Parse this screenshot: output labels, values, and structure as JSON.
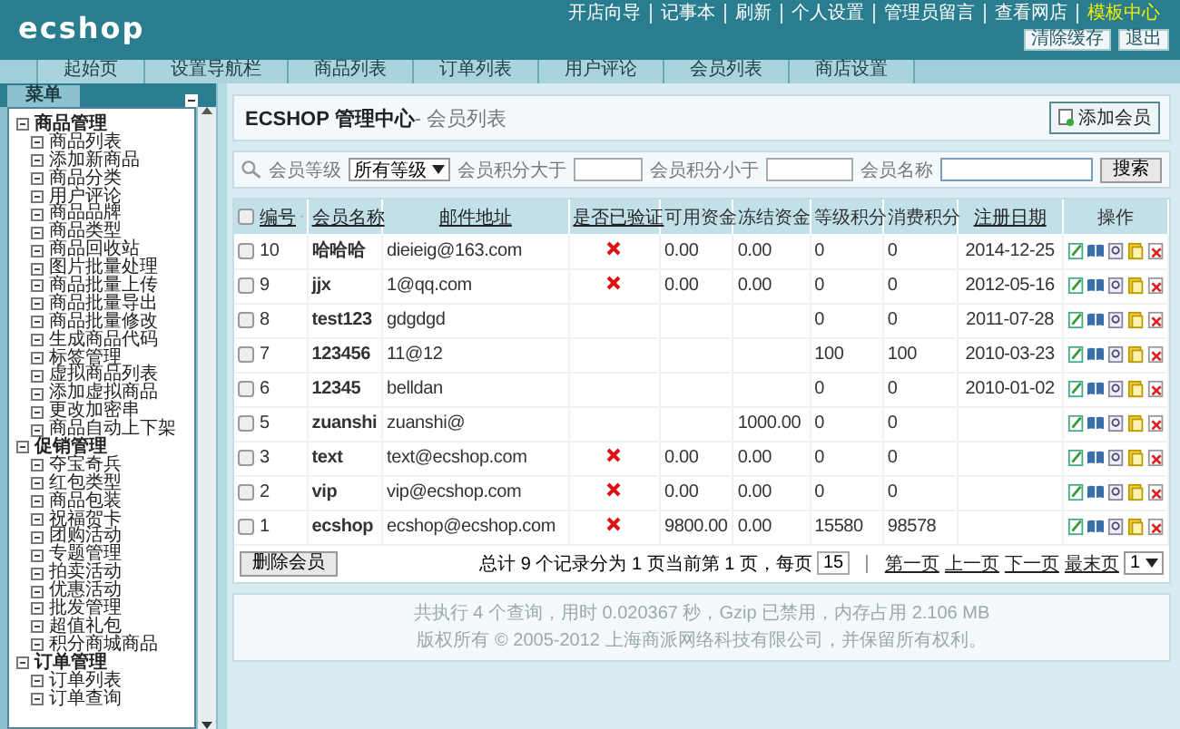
{
  "header": {
    "logo": "ecshop",
    "links": [
      {
        "label": "开店向导",
        "highlighted": false
      },
      {
        "label": "记事本",
        "highlighted": false
      },
      {
        "label": "刷新",
        "highlighted": false
      },
      {
        "label": "个人设置",
        "highlighted": false
      },
      {
        "label": "管理员留言",
        "highlighted": false
      },
      {
        "label": "查看网店",
        "highlighted": false
      },
      {
        "label": "模板中心",
        "highlighted": true
      }
    ],
    "buttons": [
      "清除缓存",
      "退出"
    ]
  },
  "nav_tabs": [
    "起始页",
    "设置导航栏",
    "商品列表",
    "订单列表",
    "用户评论",
    "会员列表",
    "商店设置"
  ],
  "sidebar": {
    "title": "菜单",
    "groups": [
      {
        "label": "商品管理",
        "expanded": true,
        "children": [
          "商品列表",
          "添加新商品",
          "商品分类",
          "用户评论",
          "商品品牌",
          "商品类型",
          "商品回收站",
          "图片批量处理",
          "商品批量上传",
          "商品批量导出",
          "商品批量修改",
          "生成商品代码",
          "标签管理",
          "虚拟商品列表",
          "添加虚拟商品",
          "更改加密串",
          "商品自动上下架"
        ]
      },
      {
        "label": "促销管理",
        "expanded": true,
        "children": [
          "夺宝奇兵",
          "红包类型",
          "商品包装",
          "祝福贺卡",
          "团购活动",
          "专题管理",
          "拍卖活动",
          "优惠活动",
          "批发管理",
          "超值礼包",
          "积分商城商品"
        ]
      },
      {
        "label": "订单管理",
        "expanded": true,
        "children": [
          "订单列表",
          "订单查询"
        ]
      }
    ]
  },
  "page_title": {
    "main": "ECSHOP 管理中心",
    "sub": "- 会员列表",
    "action": "添加会员"
  },
  "search": {
    "level_label": "会员等级",
    "level_value": "所有等级",
    "min_label": "会员积分大于",
    "max_label": "会员积分小于",
    "name_label": "会员名称",
    "button": "搜索"
  },
  "table": {
    "select_all": {
      "checked": false
    },
    "columns": [
      "编号",
      "会员名称",
      "邮件地址",
      "是否已验证",
      "可用资金",
      "冻结资金",
      "等级积分",
      "消费积分",
      "注册日期",
      "操作"
    ],
    "rows": [
      {
        "id": "10",
        "name": "哈哈哈",
        "email": "dieieig@163.com",
        "verified": false,
        "available": "0.00",
        "frozen": "0.00",
        "rank_points": "0",
        "pay_points": "0",
        "reg_date": "2014-12-25",
        "checked": false
      },
      {
        "id": "9",
        "name": "jjx",
        "email": "1@qq.com",
        "verified": false,
        "available": "0.00",
        "frozen": "0.00",
        "rank_points": "0",
        "pay_points": "0",
        "reg_date": "2012-05-16",
        "checked": false
      },
      {
        "id": "8",
        "name": "test123",
        "email": "gdgdgd",
        "verified": null,
        "available": "",
        "frozen": "",
        "rank_points": "0",
        "pay_points": "0",
        "reg_date": "2011-07-28",
        "checked": false
      },
      {
        "id": "7",
        "name": "123456",
        "email": "11@12",
        "verified": null,
        "available": "",
        "frozen": "",
        "rank_points": "100",
        "pay_points": "100",
        "reg_date": "2010-03-23",
        "checked": false
      },
      {
        "id": "6",
        "name": "12345",
        "email": "belldan",
        "verified": null,
        "available": "",
        "frozen": "",
        "rank_points": "0",
        "pay_points": "0",
        "reg_date": "2010-01-02",
        "checked": false
      },
      {
        "id": "5",
        "name": "zuanshi",
        "email": "zuanshi@",
        "verified": null,
        "available": "",
        "frozen": "1000.00",
        "rank_points": "0",
        "pay_points": "0",
        "reg_date": "",
        "checked": false
      },
      {
        "id": "3",
        "name": "text",
        "email": "text@ecshop.com",
        "verified": false,
        "available": "0.00",
        "frozen": "0.00",
        "rank_points": "0",
        "pay_points": "0",
        "reg_date": "",
        "checked": false
      },
      {
        "id": "2",
        "name": "vip",
        "email": "vip@ecshop.com",
        "verified": false,
        "available": "0.00",
        "frozen": "0.00",
        "rank_points": "0",
        "pay_points": "0",
        "reg_date": "",
        "checked": false
      },
      {
        "id": "1",
        "name": "ecshop",
        "email": "ecshop@ecshop.com",
        "verified": false,
        "available": "9800.00",
        "frozen": "0.00",
        "rank_points": "15580",
        "pay_points": "98578",
        "reg_date": "",
        "checked": false
      }
    ]
  },
  "bulk_button": "删除会员",
  "pagination": {
    "summary": "总计 9 个记录分为 1 页当前第 1 页，每页",
    "per_page": "15",
    "links": [
      "第一页",
      "上一页",
      "下一页",
      "最末页"
    ],
    "page": "1"
  },
  "footer": [
    "共执行 4 个查询，用时 0.020367 秒，Gzip 已禁用，内存占用 2.106 MB",
    "版权所有 © 2005-2012 上海商派网络科技有限公司，并保留所有权利。"
  ]
}
